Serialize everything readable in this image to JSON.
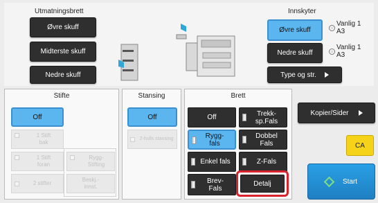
{
  "output_tray": {
    "title": "Utmatningsbrett",
    "buttons": [
      "Øvre skuff",
      "Midterste skuff",
      "Nedre skuff"
    ]
  },
  "inserter": {
    "title": "Innskyter",
    "upper": {
      "label": "Øvre skuff",
      "paper_type": "Vanlig 1",
      "paper_size": "A3"
    },
    "lower": {
      "label": "Nedre skuff",
      "paper_type": "Vanlig 1",
      "paper_size": "A3"
    },
    "type_size_label": "Type og str."
  },
  "staple": {
    "title": "Stifte",
    "off_label": "Off",
    "one_back": "1 Stift bak",
    "one_front": "1 Stift foran",
    "two": "2 stifter",
    "saddle": "Rygg-Stifting",
    "trim": "Beskj.-innst."
  },
  "punch": {
    "title": "Stansing",
    "off_label": "Off",
    "two_hole": "2-hulls stansing"
  },
  "fold": {
    "title": "Brett",
    "off_label": "Off",
    "tri_fold_line1": "Trekk-",
    "tri_fold_line2": "sp.Fals",
    "saddle_line1": "Rygg-",
    "saddle_line2": "fals",
    "double_line1": "Dobbel",
    "double_line2": "Fals",
    "single": "Enkel fals",
    "z": "Z-Fals",
    "letter_line1": "Brev-",
    "letter_line2": "Fals",
    "detail": "Detalj"
  },
  "right": {
    "copies_label": "Kopier/Sider",
    "ca_label": "CA",
    "start_label": "Start"
  },
  "colors": {
    "accent_blue": "#5bb6f0",
    "highlight_red": "#d8232f",
    "ca_yellow": "#f5d319",
    "start_blue": "#1f8fd7"
  }
}
